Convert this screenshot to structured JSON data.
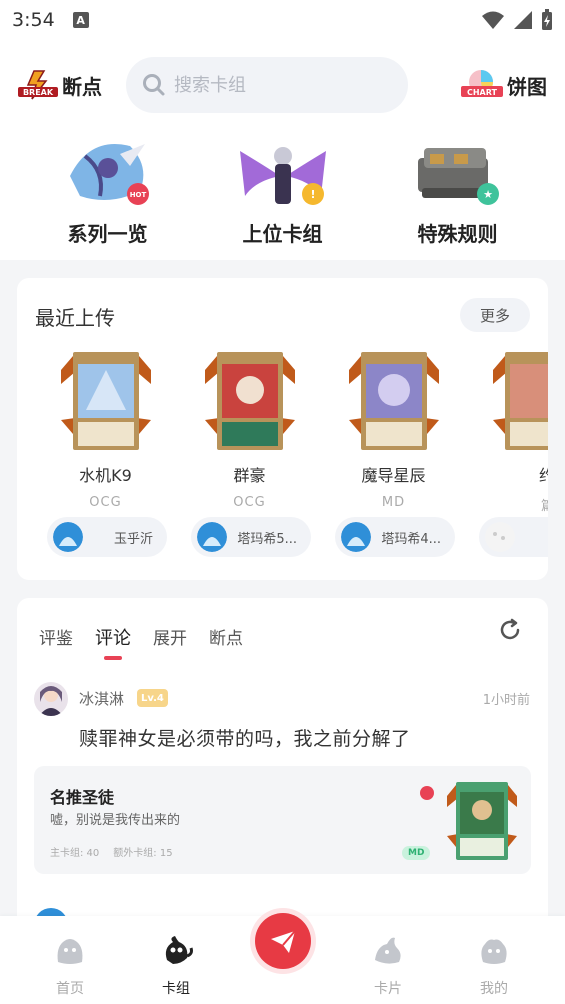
{
  "status_bar": {
    "time": "3:54",
    "notif_letter": "A"
  },
  "header": {
    "brand_label": "断点",
    "brand_logo_text": "BREAK",
    "search_placeholder": "搜索卡组",
    "chart_label": "饼图",
    "chart_logo_text": "CHART"
  },
  "categories": [
    {
      "label": "系列一览",
      "badge": "HOT",
      "badge_color": "#e84255"
    },
    {
      "label": "上位卡组",
      "badge": "!",
      "badge_color": "#f5b82e"
    },
    {
      "label": "特殊规则",
      "badge": "★",
      "badge_color": "#3fc39b"
    }
  ],
  "recent": {
    "title": "最近上传",
    "more_label": "更多",
    "decks": [
      {
        "name": "水机K9",
        "tag": "OCG",
        "user": "玉乎沂",
        "card_color": "#9fc4ea"
      },
      {
        "name": "群豪",
        "tag": "OCG",
        "user": "塔玛希5...",
        "card_color": "#c9433e"
      },
      {
        "name": "魔导星辰",
        "tag": "MD",
        "user": "塔玛希4...",
        "card_color": "#8c86c8"
      },
      {
        "name": "约",
        "tag": "篇",
        "user": "",
        "card_color": "#d88f7a"
      }
    ]
  },
  "comments": {
    "tabs": [
      "评鉴",
      "评论",
      "展开",
      "断点"
    ],
    "active_tab": 1,
    "item": {
      "user": "冰淇淋",
      "level": "Lv.4",
      "time": "1小时前",
      "text": "赎罪神女是必须带的吗，我之前分解了",
      "quote": {
        "title": "名推圣徒",
        "subtitle": "嘘，别说是我传出来的",
        "main_deck": "主卡组: 40",
        "extra_deck": "额外卡组: 15",
        "badge": "MD"
      }
    }
  },
  "bottom_nav": {
    "items": [
      "首页",
      "卡组",
      "卡片",
      "我的"
    ],
    "active": 1
  },
  "colors": {
    "accent": "#e73a44",
    "md_green": "#2fb173",
    "level_gold": "#f7d58a"
  }
}
